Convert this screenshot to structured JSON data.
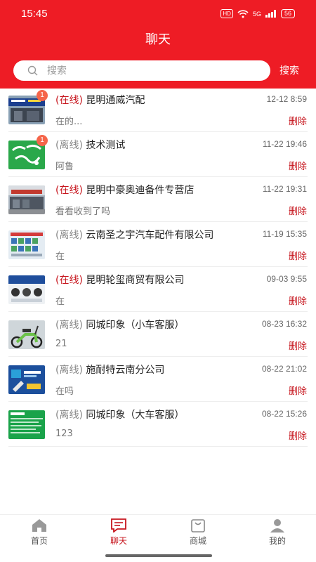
{
  "status_bar": {
    "time": "15:45",
    "hd": "HD",
    "network": "5G",
    "battery": "56"
  },
  "header": {
    "title": "聊天"
  },
  "search": {
    "placeholder": "搜索",
    "button_label": "搜索"
  },
  "chats": [
    {
      "status": "(在线)",
      "online": true,
      "name": "昆明通威汽配",
      "time": "12-12 8:59",
      "message": "在的...",
      "unread": "1",
      "delete_label": "删除",
      "avatar": "storefront-photo"
    },
    {
      "status": "(离线)",
      "online": false,
      "name": "技术测试",
      "time": "11-22 19:46",
      "message": "阿鲁",
      "unread": "1",
      "delete_label": "删除",
      "avatar": "tongcheng-logo"
    },
    {
      "status": "(在线)",
      "online": true,
      "name": "昆明中豪奥迪备件专营店",
      "time": "11-22 19:31",
      "message": "看看收到了吗",
      "unread": "",
      "delete_label": "删除",
      "avatar": "street-photo"
    },
    {
      "status": "(离线)",
      "online": false,
      "name": "云南圣之宇汽车配件有限公司",
      "time": "11-19 15:35",
      "message": "在",
      "unread": "",
      "delete_label": "删除",
      "avatar": "business-license"
    },
    {
      "status": "(在线)",
      "online": true,
      "name": "昆明轮玺商贸有限公司",
      "time": "09-03 9:55",
      "message": "在",
      "unread": "",
      "delete_label": "删除",
      "avatar": "product-banner"
    },
    {
      "status": "(离线)",
      "online": false,
      "name": "同城印象（小车客服）",
      "time": "08-23 16:32",
      "message": "21",
      "unread": "",
      "delete_label": "删除",
      "avatar": "scooter-photo"
    },
    {
      "status": "(离线)",
      "online": false,
      "name": "施耐特云南分公司",
      "time": "08-22 21:02",
      "message": "在吗",
      "unread": "",
      "delete_label": "删除",
      "avatar": "tools-banner"
    },
    {
      "status": "(离线)",
      "online": false,
      "name": "同城印象（大车客服）",
      "time": "08-22 15:26",
      "message": "123",
      "unread": "",
      "delete_label": "删除",
      "avatar": "green-card"
    }
  ],
  "tabbar": {
    "items": [
      {
        "label": "首页",
        "icon": "home-icon",
        "active": false
      },
      {
        "label": "聊天",
        "icon": "chat-icon",
        "active": true
      },
      {
        "label": "商城",
        "icon": "shop-bag-icon",
        "active": false
      },
      {
        "label": "我的",
        "icon": "profile-icon",
        "active": false
      }
    ]
  },
  "colors": {
    "brand": "#ee1c25",
    "accent": "#c7161e",
    "online": "#c7161e",
    "offline": "#888888",
    "badge": "#f5654a"
  }
}
